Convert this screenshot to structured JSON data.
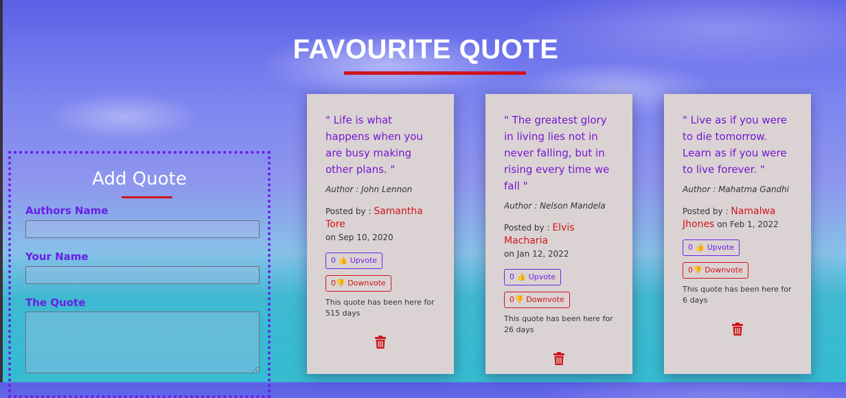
{
  "page": {
    "title": "FAVOURITE QUOTE"
  },
  "colors": {
    "accent": "#6a1ee6",
    "danger": "#d0131a",
    "card": "#dbd3d3"
  },
  "form": {
    "title": "Add Quote",
    "author_label": "Authors Name",
    "author_value": "",
    "name_label": "Your Name",
    "name_value": "",
    "quote_label": "The Quote",
    "quote_value": ""
  },
  "quotes": [
    {
      "text": "\" Life is what happens when you are busy making other plans. \"",
      "author": "Author : John Lennon",
      "posted_by_label": "Posted by : ",
      "poster": "Samantha Tore",
      "date": "on Sep 10, 2020",
      "upvote": "0",
      "upvote_label": "Upvote",
      "downvote": "0",
      "downvote_label": "Downvote",
      "age": "This quote has been here for 515 days",
      "icon": "trash-icon"
    },
    {
      "text": "\" The greatest glory in living lies not in never falling, but in rising every time we fall \"",
      "author": "Author : Nelson Mandela",
      "posted_by_label": "Posted by : ",
      "poster": "Elvis Macharia",
      "date": "on Jan 12, 2022",
      "upvote": "0",
      "upvote_label": "Upvote",
      "downvote": "0",
      "downvote_label": "Downvote",
      "age": "This quote has been here for 26 days",
      "icon": "trash-icon"
    },
    {
      "text": "\" Live as if you were to die tomorrow. Learn as if you were to live forever. \"",
      "author": "Author : Mahatma Gandhi",
      "posted_by_label": "Posted by : ",
      "poster": "Namalwa Jhones",
      "date": "on Feb 1, 2022",
      "upvote": "0",
      "upvote_label": "Upvote",
      "downvote": "0",
      "downvote_label": "Downvote",
      "age": "This quote has been here for 6 days",
      "icon": "trash-icon"
    }
  ]
}
